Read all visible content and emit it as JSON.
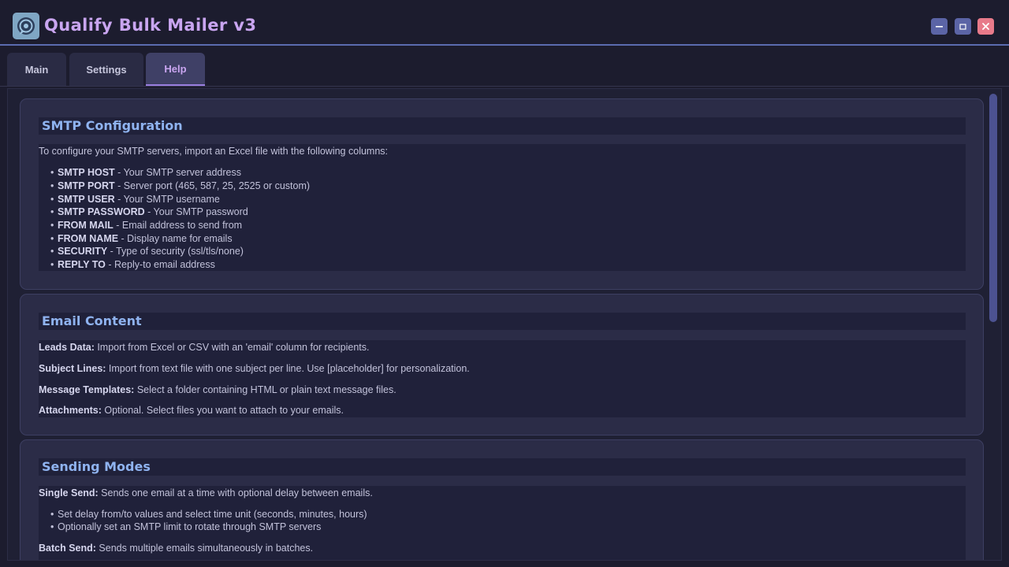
{
  "app": {
    "title": "Qualify Bulk Mailer v3",
    "logo_icon": "chat-bubble-icon",
    "window_controls": {
      "minimize": "–",
      "maximize": "□",
      "close": "✕"
    }
  },
  "tabs": [
    {
      "label": "Main"
    },
    {
      "label": "Settings"
    },
    {
      "label": "Help",
      "active": true
    }
  ],
  "colors": {
    "accent": "#c9a5f0",
    "heading": "#8fb3f0",
    "background": "#1c1c2e",
    "panel": "#2b2c47",
    "close": "#e87a8a"
  },
  "help": {
    "smtp": {
      "title": "SMTP Configuration",
      "intro": "To configure your SMTP servers, import an Excel file with the following columns:",
      "items": [
        {
          "term": "SMTP HOST",
          "desc": " - Your SMTP server address"
        },
        {
          "term": "SMTP PORT",
          "desc": " - Server port (465, 587, 25, 2525 or custom)"
        },
        {
          "term": "SMTP USER",
          "desc": " - Your SMTP username"
        },
        {
          "term": "SMTP PASSWORD",
          "desc": " - Your SMTP password"
        },
        {
          "term": "FROM MAIL",
          "desc": " - Email address to send from"
        },
        {
          "term": "FROM NAME",
          "desc": " - Display name for emails"
        },
        {
          "term": "SECURITY",
          "desc": " - Type of security (ssl/tls/none)"
        },
        {
          "term": "REPLY TO",
          "desc": " - Reply-to email address"
        }
      ]
    },
    "content": {
      "title": "Email Content",
      "items": [
        {
          "term": "Leads Data:",
          "desc": " Import from Excel or CSV with an 'email' column for recipients."
        },
        {
          "term": "Subject Lines:",
          "desc": " Import from text file with one subject per line. Use [placeholder] for personalization."
        },
        {
          "term": "Message Templates:",
          "desc": " Select a folder containing HTML or plain text message files."
        },
        {
          "term": "Attachments:",
          "desc": " Optional. Select files you want to attach to your emails."
        }
      ]
    },
    "modes": {
      "title": "Sending Modes",
      "single": {
        "term": "Single Send:",
        "desc": " Sends one email at a time with optional delay between emails."
      },
      "single_bullets": [
        "Set delay from/to values and select time unit (seconds, minutes, hours)",
        "Optionally set an SMTP limit to rotate through SMTP servers"
      ],
      "batch": {
        "term": "Batch Send:",
        "desc": " Sends multiple emails simultaneously in batches."
      }
    }
  }
}
